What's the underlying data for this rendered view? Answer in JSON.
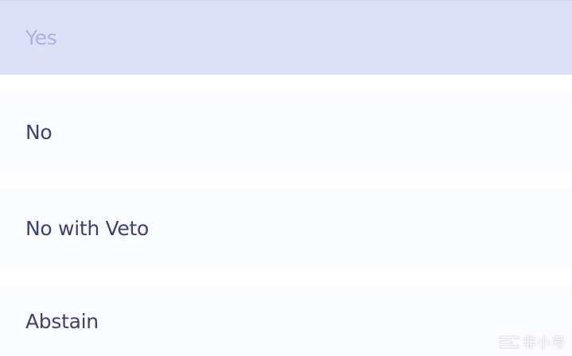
{
  "vote_options": [
    {
      "label": "Yes",
      "state": "selected"
    },
    {
      "label": "No",
      "state": "default"
    },
    {
      "label": "No with Veto",
      "state": "default"
    },
    {
      "label": "Abstain",
      "state": "default"
    }
  ],
  "watermark": {
    "text": "非小号"
  },
  "colors": {
    "selected_bg": "#dde1f6",
    "selected_text": "#a7b2e6",
    "option_bg": "#fafbfe",
    "option_text": "#3d4370"
  }
}
